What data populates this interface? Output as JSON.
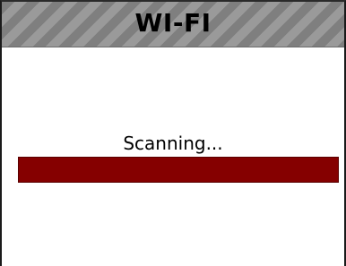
{
  "header": {
    "title": "WI-FI"
  },
  "status": {
    "text": "Scanning..."
  },
  "progress": {
    "fraction": 1.0
  },
  "colors": {
    "progress_fill": "#850000",
    "header_stripe_dark": "#7f7f7f",
    "header_stripe_light": "#9a9a9a"
  }
}
